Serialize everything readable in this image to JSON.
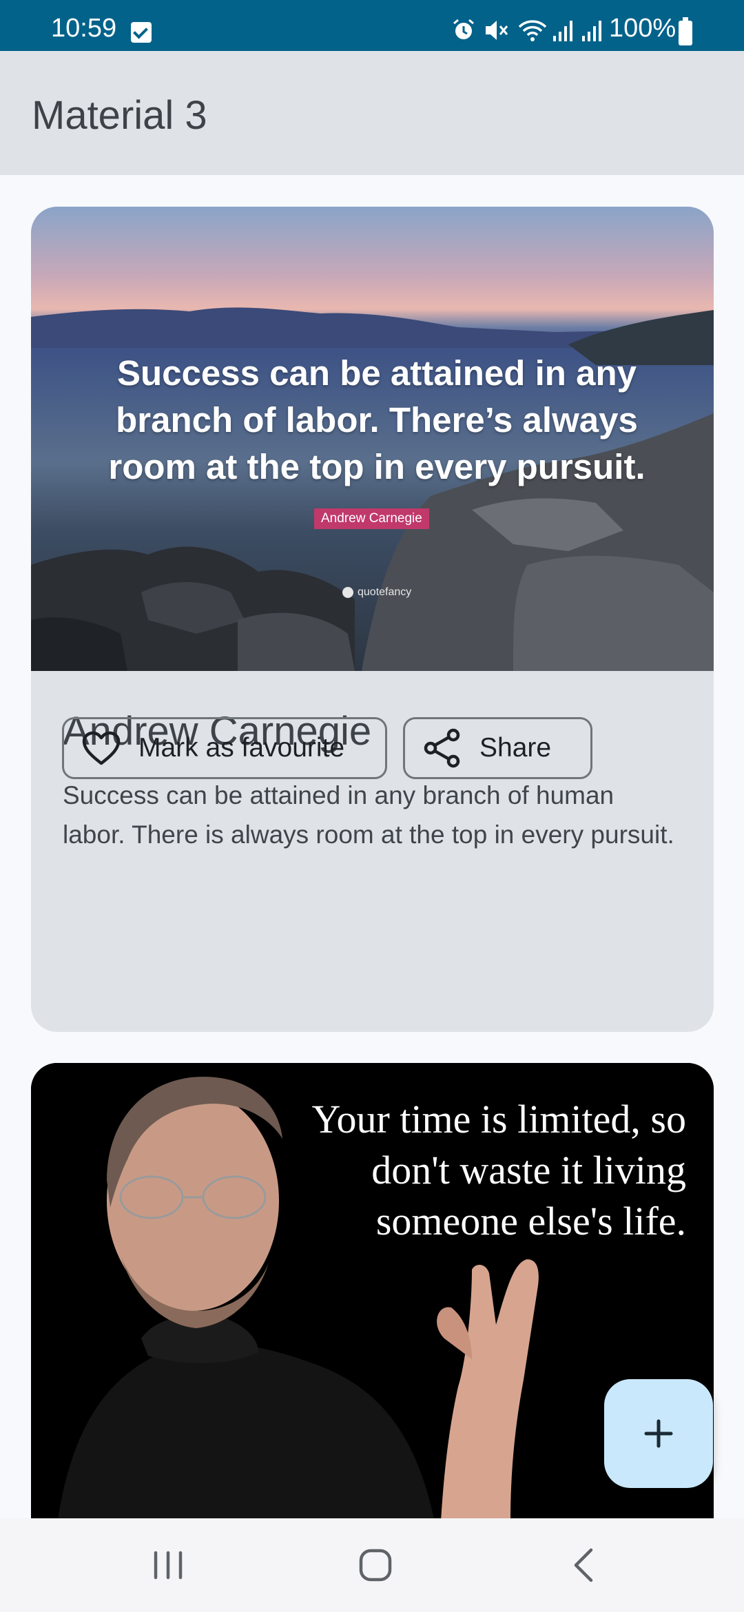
{
  "status_bar": {
    "time": "10:59",
    "battery": "100%",
    "icons": [
      "check-notification-icon",
      "alarm-icon",
      "mute-icon",
      "wifi-icon",
      "signal-icon",
      "signal-icon",
      "battery-icon"
    ]
  },
  "app_bar": {
    "title": "Material 3"
  },
  "cards": [
    {
      "image": {
        "quote": "Success can be attained in any branch of labor. There’s always room at the top in every pursuit.",
        "author_tag": "Andrew Carnegie",
        "watermark": "quotefancy"
      },
      "title": "Andrew Carnegie",
      "text": "Success can be attained in any branch of human labor. There is always room at the top in every pursuit.",
      "buttons": {
        "favourite": "Mark as favourite",
        "share": "Share"
      }
    },
    {
      "image": {
        "quote_lines": [
          "Your time is limited, so",
          "don't waste it living",
          "someone else's life."
        ]
      }
    }
  ],
  "fab": {
    "icon": "plus-icon"
  },
  "nav_bar": {
    "icons": [
      "recent-apps-icon",
      "home-icon",
      "back-icon"
    ]
  },
  "colors": {
    "status_bar": "#03628a",
    "app_bar": "#dfe3e8",
    "card": "#dfe3e8",
    "fab": "#c9e8fb",
    "author_tag": "#c0396a"
  }
}
